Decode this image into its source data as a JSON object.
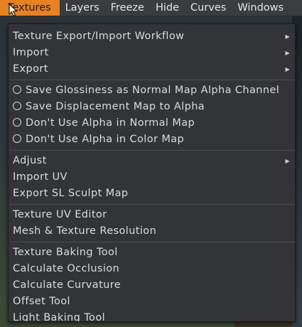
{
  "menubar": {
    "items": [
      "Textures",
      "Layers",
      "Freeze",
      "Hide",
      "Curves",
      "Windows"
    ]
  },
  "colors": {
    "accent": "#e8811f",
    "menu_bg": "#323437",
    "menubar_bg": "#3a3c3f"
  },
  "dropdown": {
    "group1": [
      {
        "label": "Texture Export/Import Workflow",
        "submenu": true
      },
      {
        "label": "Import",
        "submenu": true
      },
      {
        "label": "Export",
        "submenu": true
      }
    ],
    "group2": [
      {
        "label": "Save Glossiness as Normal Map Alpha Channel",
        "radio": true
      },
      {
        "label": "Save Displacement Map to Alpha",
        "radio": true
      },
      {
        "label": "Don't Use Alpha in Normal Map",
        "radio": true
      },
      {
        "label": "Don't Use Alpha in Color Map",
        "radio": true
      }
    ],
    "group3": [
      {
        "label": "Adjust",
        "submenu": true
      },
      {
        "label": "Import UV"
      },
      {
        "label": "Export SL Sculpt Map"
      }
    ],
    "group4": [
      {
        "label": "Texture UV Editor"
      },
      {
        "label": "Mesh & Texture Resolution"
      }
    ],
    "group5": [
      {
        "label": "Texture Baking Tool"
      },
      {
        "label": "Calculate Occlusion"
      },
      {
        "label": "Calculate Curvature"
      },
      {
        "label": "Offset Tool"
      },
      {
        "label": "Light Baking Tool"
      }
    ],
    "submenu_arrow": "▶"
  }
}
